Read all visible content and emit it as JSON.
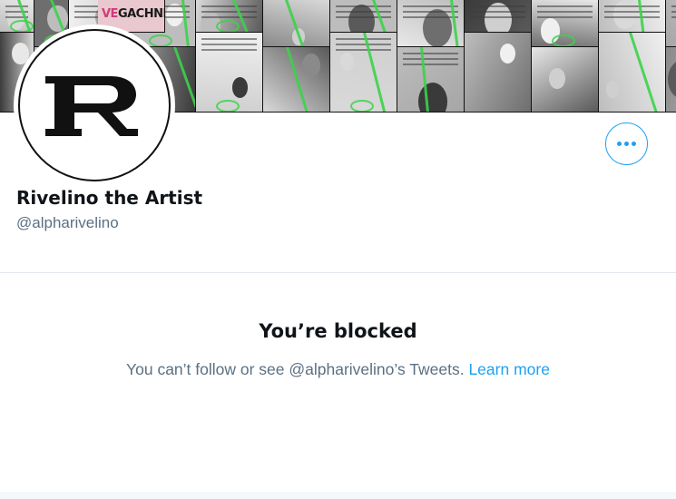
{
  "profile": {
    "display_name": "Rivelino the Artist",
    "handle": "@alpharivelino",
    "avatar_letter": "R"
  },
  "banner": {
    "fragments": [
      "VE",
      "GACHNINT"
    ]
  },
  "more_button": {
    "icon": "more-horizontal-icon"
  },
  "blocked": {
    "title": "You’re blocked",
    "message": "You can’t follow or see @alpharivelino’s Tweets.",
    "link_label": "Learn more"
  },
  "colors": {
    "accent": "#1da1f2",
    "secondary_text": "#5b7083",
    "primary_text": "#0f1419",
    "banner_marker": "#3cd24a"
  }
}
